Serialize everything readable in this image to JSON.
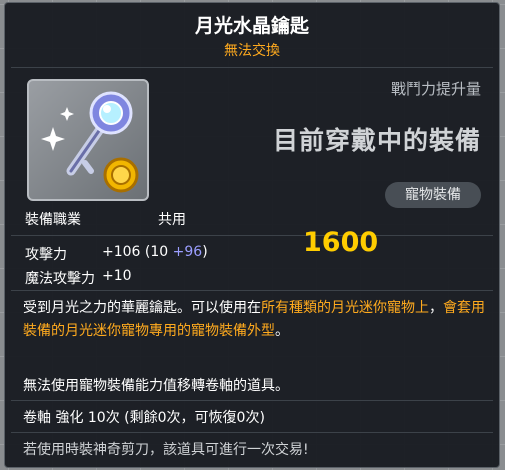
{
  "item": {
    "name": "月光水晶鑰匙",
    "trade": "無法交換"
  },
  "compare": {
    "combat_label": "戰鬥力提升量",
    "equipped_text": "目前穿戴中的裝備",
    "category": "寵物裝備",
    "power_value": "1600"
  },
  "stats": {
    "job_label": "裝備職業",
    "job_value": "共用",
    "atk_label": "攻擊力",
    "atk_value": "+106 (10 ",
    "atk_extra": "+96",
    "atk_close": ")",
    "matk_label": "魔法攻擊力",
    "matk_value": "+10"
  },
  "description": {
    "part1": "受到月光之力的華麗鑰匙。可以使用在",
    "hl1": "所有種類的月光迷你寵物上",
    "part2": "，",
    "hl2": "會套用裝備的月光迷你寵物專用的寵物裝備外型",
    "part3": "。",
    "line2": "無法使用寵物裝備能力值移轉卷軸的道具。"
  },
  "scroll": {
    "text": "卷軸 強化 10次 (剩餘0次，可恢復0次)"
  },
  "footer": {
    "trade_note": "若使用時裝神奇剪刀，該道具可進行一次交易!"
  },
  "colors": {
    "title": "#ffffff",
    "subtitle": "#ffaa1e",
    "highlight": "#ffaa1e",
    "power": "#ffcd00",
    "bonus": "#9b9eff"
  },
  "icon": "crystal-key-icon"
}
